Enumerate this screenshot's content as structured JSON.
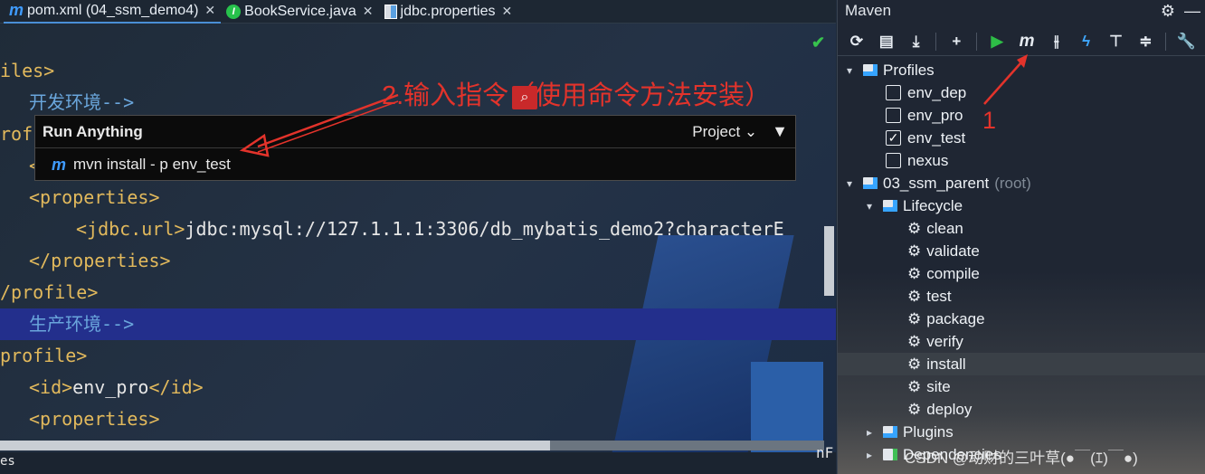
{
  "tabs": [
    {
      "icon": "m",
      "label": "pom.xml (04_ssm_demo4)",
      "active": true
    },
    {
      "icon": "I",
      "label": "BookService.java",
      "active": false
    },
    {
      "icon": "properties",
      "label": "jdbc.properties",
      "active": false
    }
  ],
  "code": {
    "l1": "iles>",
    "l2": "开发环境-->",
    "l3": "rof",
    "l4": "<",
    "l5a": "<properties>",
    "l6a": "<jdbc.url>",
    "l6b": "jdbc:mysql://127.1.1.1:3306/db_mybatis_demo2?characterE",
    "l7": "</properties>",
    "l8": "/profile>",
    "l9": "生产环境-->",
    "l10": "profile>",
    "l11a": "<id>",
    "l11b": "env_pro",
    "l11c": "</id>",
    "l12": "<properties>",
    "bottom": "es",
    "right_peek": "nF"
  },
  "annotations": {
    "step2": "2.输入指令（使用命令方法安装）",
    "step1": "1"
  },
  "popup": {
    "title": "Run Anything",
    "scope": "Project",
    "item": "mvn install - p env_test"
  },
  "maven": {
    "title": "Maven",
    "profiles_label": "Profiles",
    "profiles": [
      {
        "name": "env_dep",
        "checked": false
      },
      {
        "name": "env_pro",
        "checked": false
      },
      {
        "name": "env_test",
        "checked": true
      },
      {
        "name": "nexus",
        "checked": false
      }
    ],
    "project": "03_ssm_parent",
    "project_suffix": "(root)",
    "lifecycle_label": "Lifecycle",
    "lifecycle": [
      "clean",
      "validate",
      "compile",
      "test",
      "package",
      "verify",
      "install",
      "site",
      "deploy"
    ],
    "selected_phase": "install",
    "plugins_label": "Plugins",
    "dependencies_label": "Dependencies"
  },
  "watermark": "CSDN @动财的三叶草(●￣(ｴ)￣●)"
}
